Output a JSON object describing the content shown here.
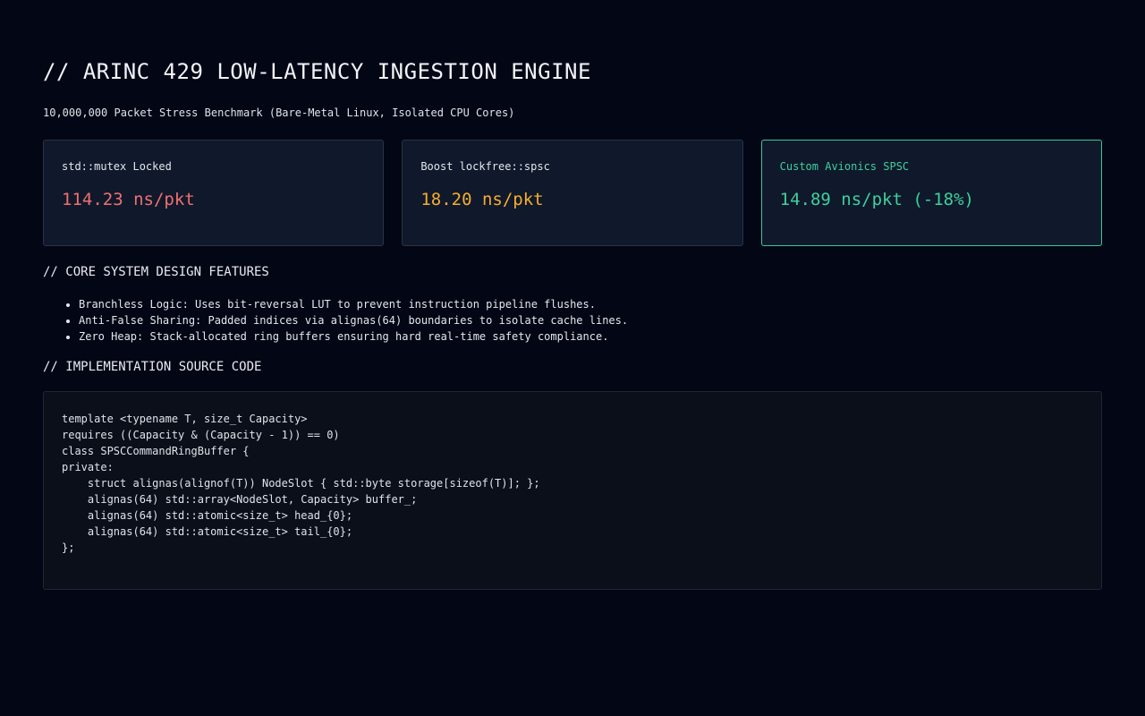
{
  "header": {
    "title": "// ARINC 429 LOW-LATENCY INGESTION ENGINE",
    "subtitle": "10,000,000 Packet Stress Benchmark (Bare-Metal Linux, Isolated CPU Cores)"
  },
  "benchmarks": [
    {
      "label": "std::mutex Locked",
      "value": "114.23 ns/pkt",
      "color": "#f06f6f"
    },
    {
      "label": "Boost lockfree::spsc",
      "value": "18.20 ns/pkt",
      "color": "#f6ad2e"
    },
    {
      "label": "Custom Avionics SPSC",
      "value": "14.89 ns/pkt (-18%)",
      "color": "#3fcf9c",
      "highlighted": true
    }
  ],
  "features": {
    "heading": "// CORE SYSTEM DESIGN FEATURES",
    "items": [
      "Branchless Logic: Uses bit-reversal LUT to prevent instruction pipeline flushes.",
      "Anti-False Sharing: Padded indices via alignas(64) boundaries to isolate cache lines.",
      "Zero Heap: Stack-allocated ring buffers ensuring hard real-time safety compliance."
    ]
  },
  "source": {
    "heading": "// IMPLEMENTATION SOURCE CODE",
    "lines": [
      "template <typename T, size_t Capacity>",
      "requires ((Capacity & (Capacity - 1)) == 0)",
      "class SPSCCommandRingBuffer {",
      "private:",
      "    struct alignas(alignof(T)) NodeSlot { std::byte storage[sizeof(T)]; };",
      "    alignas(64) std::array<NodeSlot, Capacity> buffer_;",
      "    alignas(64) std::atomic<size_t> head_{0};",
      "    alignas(64) std::atomic<size_t> tail_{0};",
      "};"
    ]
  }
}
